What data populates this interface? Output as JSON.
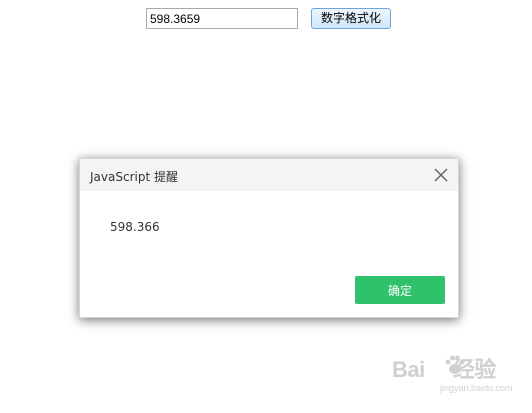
{
  "input": {
    "value": "598.3659"
  },
  "button": {
    "label": "数字格式化"
  },
  "dialog": {
    "title": "JavaScript 提醒",
    "message": "598.366",
    "ok_label": "确定",
    "close_icon": "close-icon"
  },
  "watermark": {
    "text_left": "Bai",
    "text_right": "经验",
    "sub": "jingyan.baidu.com",
    "icon": "paw-icon"
  },
  "colors": {
    "ok_button": "#2fc26b",
    "header_bg": "#f4f4f4"
  }
}
